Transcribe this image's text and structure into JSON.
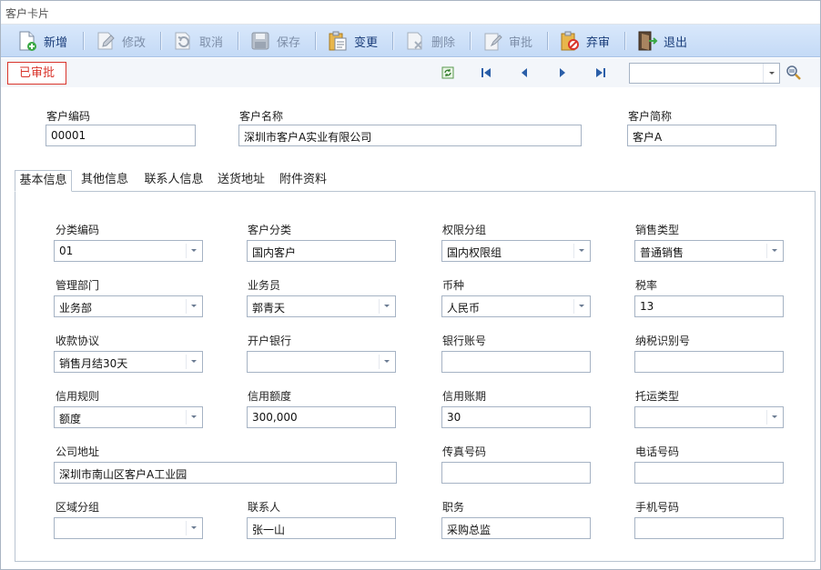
{
  "window": {
    "title": "客户卡片"
  },
  "toolbar": {
    "new_label": "新增",
    "edit_label": "修改",
    "cancel_label": "取消",
    "save_label": "保存",
    "change_label": "变更",
    "delete_label": "删除",
    "approve_label": "审批",
    "unapprove_label": "弃审",
    "exit_label": "退出"
  },
  "navbar": {
    "status": "已审批",
    "search_value": ""
  },
  "header": {
    "code_label": "客户编码",
    "code_value": "00001",
    "name_label": "客户名称",
    "name_value": "深圳市客户A实业有限公司",
    "short_label": "客户简称",
    "short_value": "客户A"
  },
  "tabs": [
    "基本信息",
    "其他信息",
    "联系人信息",
    "送货地址",
    "附件资料"
  ],
  "form": {
    "category_code_label": "分类编码",
    "category_code": "01",
    "customer_class_label": "客户分类",
    "customer_class": "国内客户",
    "permission_group_label": "权限分组",
    "permission_group": "国内权限组",
    "sales_type_label": "销售类型",
    "sales_type": "普通销售",
    "dept_label": "管理部门",
    "dept": "业务部",
    "salesman_label": "业务员",
    "salesman": "郭青天",
    "currency_label": "币种",
    "currency": "人民币",
    "tax_rate_label": "税率",
    "tax_rate": "13",
    "payment_terms_label": "收款协议",
    "payment_terms": "销售月结30天",
    "bank_label": "开户银行",
    "bank": "",
    "bank_account_label": "银行账号",
    "bank_account": "",
    "tax_id_label": "纳税识别号",
    "tax_id": "",
    "credit_rule_label": "信用规则",
    "credit_rule": "额度",
    "credit_limit_label": "信用额度",
    "credit_limit": "300,000",
    "credit_period_label": "信用账期",
    "credit_period": "30",
    "shipping_type_label": "托运类型",
    "shipping_type": "",
    "address_label": "公司地址",
    "address": "深圳市南山区客户A工业园",
    "fax_label": "传真号码",
    "fax": "",
    "phone_label": "电话号码",
    "phone": "",
    "region_label": "区域分组",
    "region": "",
    "contact_label": "联系人",
    "contact": "张一山",
    "position_label": "职务",
    "position": "采购总监",
    "mobile_label": "手机号码",
    "mobile": ""
  }
}
